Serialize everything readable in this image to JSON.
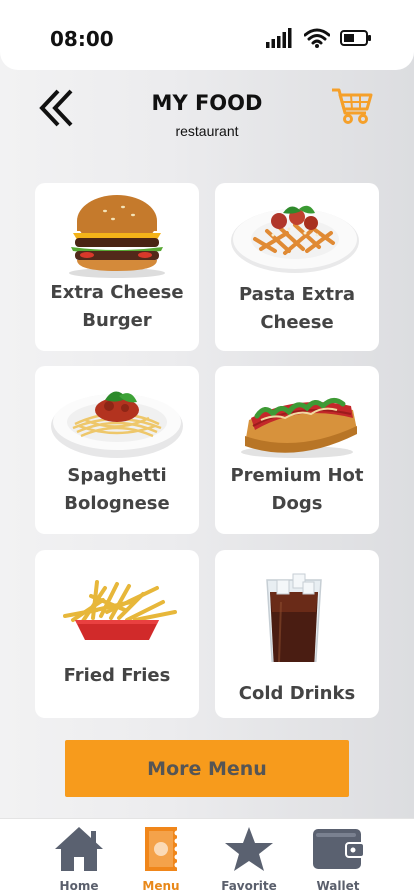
{
  "status_bar": {
    "time": "08:00",
    "icons": [
      "signal-icon",
      "wifi-icon",
      "battery-icon"
    ]
  },
  "header": {
    "title": "MY FOOD",
    "subtitle": "restaurant",
    "back_icon": "double-chevron-left-icon",
    "cart_icon": "cart-icon"
  },
  "menu": {
    "items": [
      {
        "label": "Extra Cheese Burger",
        "icon": "burger-image"
      },
      {
        "label": "Pasta Extra Cheese",
        "icon": "pasta-image"
      },
      {
        "label": "Spaghetti Bolognese",
        "icon": "spaghetti-image"
      },
      {
        "label": "Premium Hot Dogs",
        "icon": "hotdog-image"
      },
      {
        "label": "Fried Fries",
        "icon": "fries-image"
      },
      {
        "label": "Cold Drinks",
        "icon": "drink-image"
      }
    ],
    "more_label": "More Menu"
  },
  "nav": {
    "items": [
      {
        "label": "Home",
        "icon": "home-icon",
        "active": false
      },
      {
        "label": "Menu",
        "icon": "menu-icon",
        "active": true
      },
      {
        "label": "Favorite",
        "icon": "star-icon",
        "active": false
      },
      {
        "label": "Wallet",
        "icon": "wallet-icon",
        "active": false
      }
    ]
  },
  "colors": {
    "accent": "#f79b1c",
    "cart": "#f5a02a",
    "nav_icon": "#5a6170",
    "nav_label": "#5a5f6c",
    "active_label": "#e8881a",
    "card_text": "#444444"
  }
}
